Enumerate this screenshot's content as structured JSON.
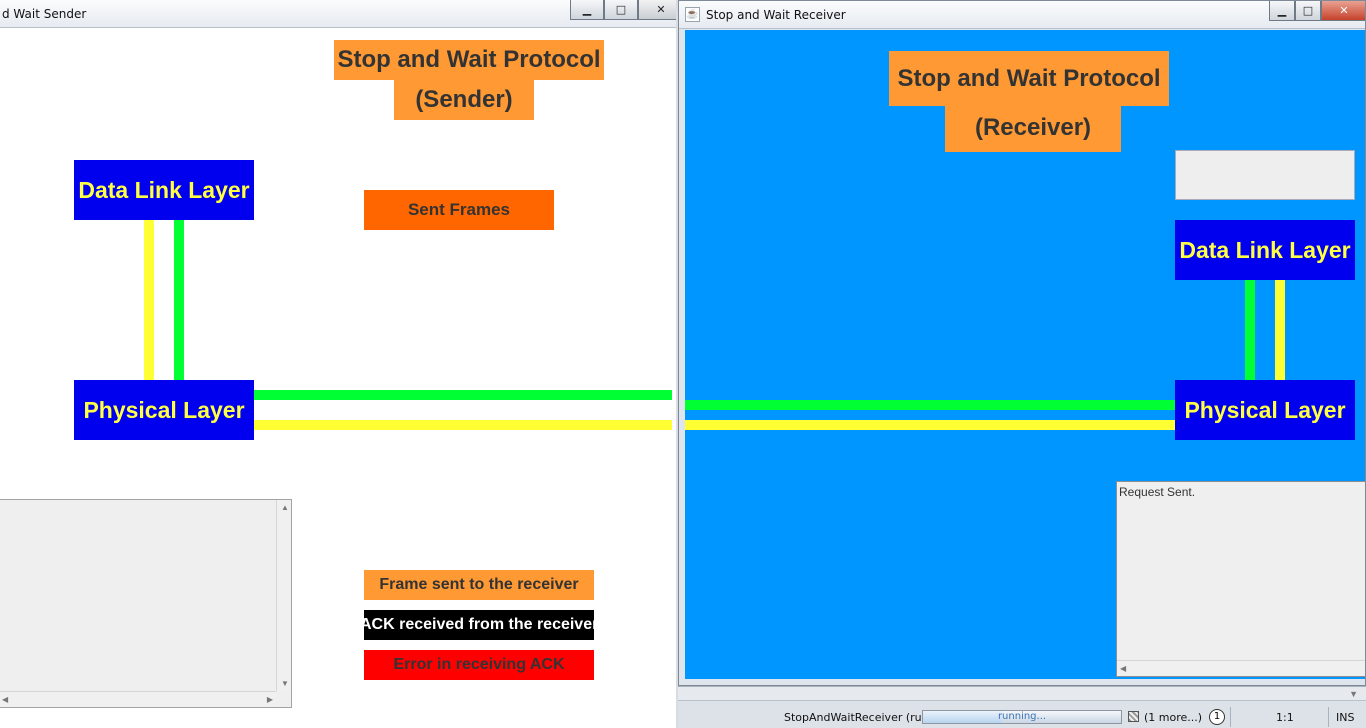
{
  "sender": {
    "title": "d Wait Sender",
    "heading_line1": "Stop and Wait Protocol",
    "heading_line2": "(Sender)",
    "data_link_layer": "Data Link Layer",
    "physical_layer": "Physical Layer",
    "sent_frames": "Sent Frames",
    "legend": {
      "frame_sent": "Frame sent to the receiver",
      "ack_received": "ACK received from the receiver",
      "error_ack": "Error in receiving ACK"
    },
    "log_text": ""
  },
  "receiver": {
    "title": "Stop and Wait Receiver",
    "heading_line1": "Stop and Wait Protocol",
    "heading_line2": "(Receiver)",
    "data_link_layer": "Data Link Layer",
    "physical_layer": "Physical Layer",
    "frame_box_value": "",
    "log_text": "Request Sent."
  },
  "window_buttons": {
    "minimize": "▁",
    "maximize": "□",
    "close": "✕"
  },
  "statusbar": {
    "process": "StopAndWaitReceiver (run)",
    "progress_label": "running...",
    "progress_fraction": 0.4,
    "more": "(1 more...)",
    "notification_count": "1",
    "position": "1:1",
    "mode": "INS"
  },
  "colors": {
    "sender_bg": "#ffffff",
    "receiver_bg": "#0096ff",
    "layer_box": "#0000ee",
    "layer_text": "#ffff44",
    "heading_box": "#ff9933",
    "sent_frames_box": "#ff6600",
    "frame_line": "#ffff33",
    "ack_line": "#00ff33",
    "error": "#ff0000"
  }
}
